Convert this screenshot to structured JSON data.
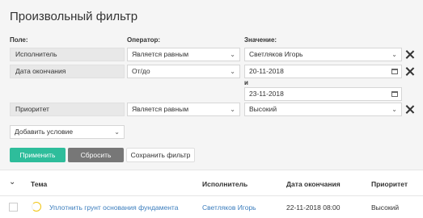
{
  "filter": {
    "title": "Произвольный фильтр",
    "col_field": "Поле:",
    "col_operator": "Оператор:",
    "col_value": "Значение:",
    "rows": [
      {
        "field": "Исполнитель",
        "operator": "Является равным",
        "value": "Светляков Игорь"
      },
      {
        "field": "Дата окончания",
        "operator": "От/до",
        "value_from": "20-11-2018",
        "and_label": "и",
        "value_to": "23-11-2018"
      },
      {
        "field": "Приоритет",
        "operator": "Является равным",
        "value": "Высокий"
      }
    ],
    "add_condition": "Добавить условие",
    "apply": "Применить",
    "reset": "Сбросить",
    "save": "Сохранить фильтр"
  },
  "table": {
    "headers": [
      "Тема",
      "Исполнитель",
      "Дата окончания",
      "Приоритет"
    ],
    "rows": [
      {
        "topic": "Уплотнить грунт основания фундамента",
        "assignee": "Светляков Игорь",
        "due": "22-11-2018 08:00",
        "priority": "Высокий"
      }
    ]
  },
  "colors": {
    "accent": "#2ebd9b",
    "link": "#3b7dbd",
    "reset": "#777777"
  }
}
